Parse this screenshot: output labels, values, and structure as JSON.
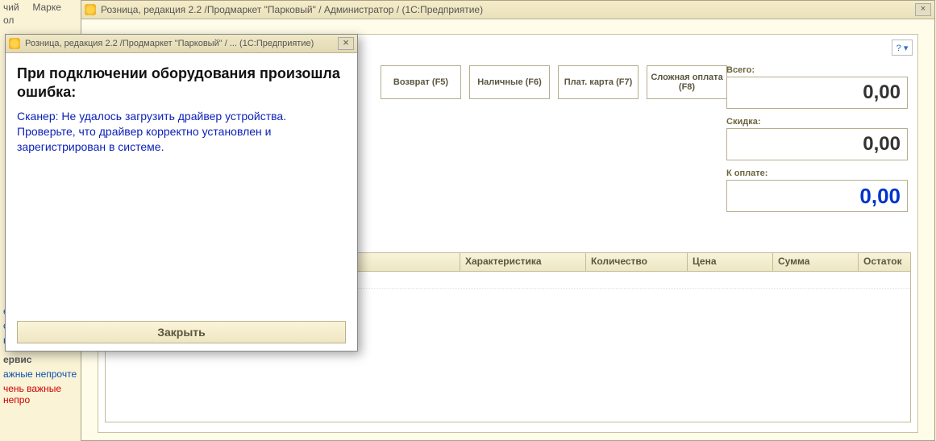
{
  "left_sidebar": {
    "top1": "чий",
    "top2": "ол",
    "market": "Марке",
    "link1": "ервоначальное",
    "link2": "се новости",
    "link3": "нтернет-поддер",
    "service_hdr": "ервис",
    "link4": "ажные непрочте",
    "link5": "чень важные непро"
  },
  "main_window": {
    "title": "Розница, редакция 2.2 /Продмаркет \"Парковый\" / Администратор /  (1С:Предприятие)",
    "close_glyph": "×",
    "help_glyph": "? ▾"
  },
  "buttons": {
    "return": "Возврат (F5)",
    "cash": "Наличные (F6)",
    "card": "Плат. карта (F7)",
    "complex": "Сложная оплата (F8)"
  },
  "totals": {
    "total_label": "Всего:",
    "total_value": "0,00",
    "discount_label": "Скидка:",
    "discount_value": "0,00",
    "topay_label": "К оплате:",
    "topay_value": "0,00"
  },
  "table": {
    "col_char": "Характеристика",
    "col_qty": "Количество",
    "col_price": "Цена",
    "col_sum": "Сумма",
    "col_rest": "Остаток"
  },
  "modal": {
    "title": "Розница, редакция 2.2 /Продмаркет \"Парковый\" / ...  (1С:Предприятие)",
    "close_glyph": "×",
    "heading": "При подключении оборудования произошла ошибка:",
    "message": "Сканер: Не удалось загрузить драйвер устройства. Проверьте, что драйвер корректно установлен и зарегистрирован в системе.",
    "close_button": "Закрыть"
  }
}
